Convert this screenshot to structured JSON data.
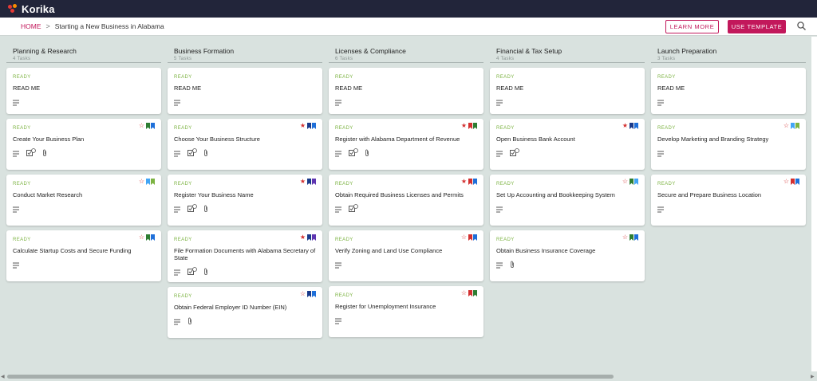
{
  "app": {
    "name": "Korika"
  },
  "breadcrumb": {
    "home": "HOME",
    "separator": ">",
    "current": "Starting a New Business in Alabama"
  },
  "actions": {
    "learn_more": "LEARN MORE",
    "use_template": "USE TEMPLATE"
  },
  "colors": {
    "brand": "#c2185b",
    "topbar": "#22253a",
    "ready": "#7cb342",
    "flag_red": "#d32f2f",
    "flag_blue": "#1e6fd9",
    "flag_green": "#2e7d32",
    "flag_navy": "#1a3a8a",
    "flag_lightblue": "#42a5f5",
    "flag_lime": "#7cb342",
    "flag_purple": "#5e35b1"
  },
  "columns": [
    {
      "title": "Planning & Research",
      "count": "4 Tasks",
      "cards": [
        {
          "status": "READY",
          "title": "READ ME",
          "star": "",
          "flags": [],
          "icons": [
            "notes"
          ]
        },
        {
          "status": "READY",
          "title": "Create Your Business Plan",
          "star": "outline",
          "flags": [
            "green",
            "blue"
          ],
          "icons": [
            "notes",
            "checklist",
            "attach"
          ]
        },
        {
          "status": "READY",
          "title": "Conduct Market Research",
          "star": "outline",
          "flags": [
            "lightblue",
            "lime"
          ],
          "icons": [
            "notes"
          ]
        },
        {
          "status": "READY",
          "title": "Calculate Startup Costs and Secure Funding",
          "star": "outline",
          "flags": [
            "green",
            "blue"
          ],
          "icons": [
            "notes"
          ]
        }
      ]
    },
    {
      "title": "Business Formation",
      "count": "5 Tasks",
      "cards": [
        {
          "status": "READY",
          "title": "READ ME",
          "star": "",
          "flags": [],
          "icons": [
            "notes"
          ]
        },
        {
          "status": "READY",
          "title": "Choose Your Business Structure",
          "star": "filled",
          "flags": [
            "navy",
            "blue"
          ],
          "icons": [
            "notes",
            "checklist",
            "attach"
          ]
        },
        {
          "status": "READY",
          "title": "Register Your Business Name",
          "star": "filled",
          "flags": [
            "navy",
            "purple"
          ],
          "icons": [
            "notes",
            "checklist",
            "attach"
          ]
        },
        {
          "status": "READY",
          "title": "File Formation Documents with Alabama Secretary of State",
          "star": "filled",
          "flags": [
            "navy",
            "purple"
          ],
          "icons": [
            "notes",
            "checklist",
            "attach"
          ]
        },
        {
          "status": "READY",
          "title": "Obtain Federal Employer ID Number (EIN)",
          "star": "outline",
          "flags": [
            "navy",
            "blue"
          ],
          "icons": [
            "notes",
            "attach"
          ]
        }
      ]
    },
    {
      "title": "Licenses & Compliance",
      "count": "6 Tasks",
      "cards": [
        {
          "status": "READY",
          "title": "READ ME",
          "star": "",
          "flags": [],
          "icons": [
            "notes"
          ]
        },
        {
          "status": "READY",
          "title": "Register with Alabama Department of Revenue",
          "star": "filled",
          "flags": [
            "red",
            "green"
          ],
          "icons": [
            "notes",
            "checklist",
            "attach"
          ]
        },
        {
          "status": "READY",
          "title": "Obtain Required Business Licenses and Permits",
          "star": "filled",
          "flags": [
            "red",
            "blue"
          ],
          "icons": [
            "notes",
            "checklist"
          ]
        },
        {
          "status": "READY",
          "title": "Verify Zoning and Land Use Compliance",
          "star": "outline",
          "flags": [
            "red",
            "blue"
          ],
          "icons": [
            "notes"
          ]
        },
        {
          "status": "READY",
          "title": "Register for Unemployment Insurance",
          "star": "outline",
          "flags": [
            "red",
            "green"
          ],
          "icons": [
            "notes"
          ]
        }
      ]
    },
    {
      "title": "Financial & Tax Setup",
      "count": "4 Tasks",
      "cards": [
        {
          "status": "READY",
          "title": "READ ME",
          "star": "",
          "flags": [],
          "icons": [
            "notes"
          ]
        },
        {
          "status": "READY",
          "title": "Open Business Bank Account",
          "star": "filled",
          "flags": [
            "navy",
            "blue"
          ],
          "icons": [
            "notes",
            "checklist"
          ]
        },
        {
          "status": "READY",
          "title": "Set Up Accounting and Bookkeeping System",
          "star": "outline",
          "flags": [
            "green",
            "lightblue"
          ],
          "icons": [
            "notes"
          ]
        },
        {
          "status": "READY",
          "title": "Obtain Business Insurance Coverage",
          "star": "outline",
          "flags": [
            "green",
            "blue"
          ],
          "icons": [
            "notes",
            "attach"
          ]
        }
      ]
    },
    {
      "title": "Launch Preparation",
      "count": "3 Tasks",
      "cards": [
        {
          "status": "READY",
          "title": "READ ME",
          "star": "",
          "flags": [],
          "icons": [
            "notes"
          ]
        },
        {
          "status": "READY",
          "title": "Develop Marketing and Branding Strategy",
          "star": "outline",
          "flags": [
            "lightblue",
            "lime"
          ],
          "icons": [
            "notes"
          ]
        },
        {
          "status": "READY",
          "title": "Secure and Prepare Business Location",
          "star": "outline",
          "flags": [
            "red",
            "blue"
          ],
          "icons": [
            "notes"
          ]
        }
      ]
    }
  ]
}
